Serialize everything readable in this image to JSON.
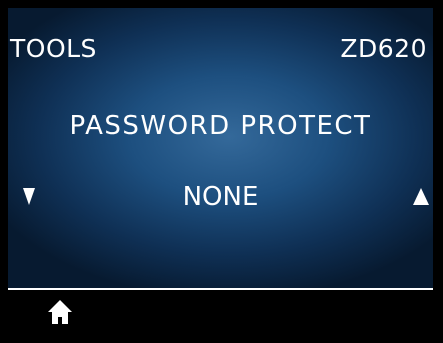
{
  "header": {
    "menu_title": "TOOLS",
    "model": "ZD620"
  },
  "setting": {
    "name": "PASSWORD PROTECT",
    "value": "NONE"
  },
  "navigation": {
    "previous_icon": "triangle-down-icon",
    "next_icon": "triangle-up-icon",
    "home_icon": "home-icon"
  },
  "colors": {
    "background_center": "#34699a",
    "background_edge": "#071a30",
    "text": "#ffffff",
    "bezel": "#000000"
  }
}
